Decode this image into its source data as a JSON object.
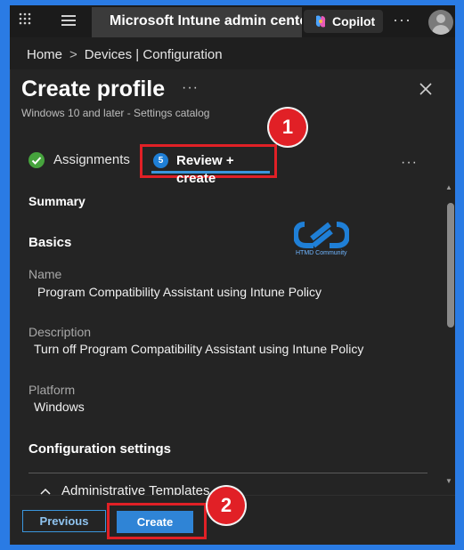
{
  "topbar": {
    "app_title": "Microsoft Intune admin center",
    "copilot_label": "Copilot",
    "more": "···"
  },
  "breadcrumb": {
    "home": "Home",
    "devices": "Devices | Configuration"
  },
  "panel": {
    "title": "Create profile",
    "title_more": "···",
    "subtitle": "Windows 10 and later - Settings catalog"
  },
  "tabs": {
    "assignments": "Assignments",
    "review_step": "5",
    "review": "Review + create",
    "more": "···"
  },
  "annotations": {
    "badge1": "1",
    "badge2": "2"
  },
  "content": {
    "summary": "Summary",
    "basics": "Basics",
    "logo_text": "HTMD Community",
    "name_label": "Name",
    "name_value": "Program Compatibility Assistant using Intune Policy",
    "description_label": "Description",
    "description_value": "Turn off Program Compatibility Assistant using Intune Policy",
    "platform_label": "Platform",
    "platform_value": "Windows",
    "config_heading": "Configuration settings",
    "admin_templates": "Administrative Templates"
  },
  "footer": {
    "previous": "Previous",
    "create": "Create"
  },
  "colors": {
    "accent": "#3a96dd",
    "highlight": "#e12026",
    "success": "#46a33d"
  }
}
